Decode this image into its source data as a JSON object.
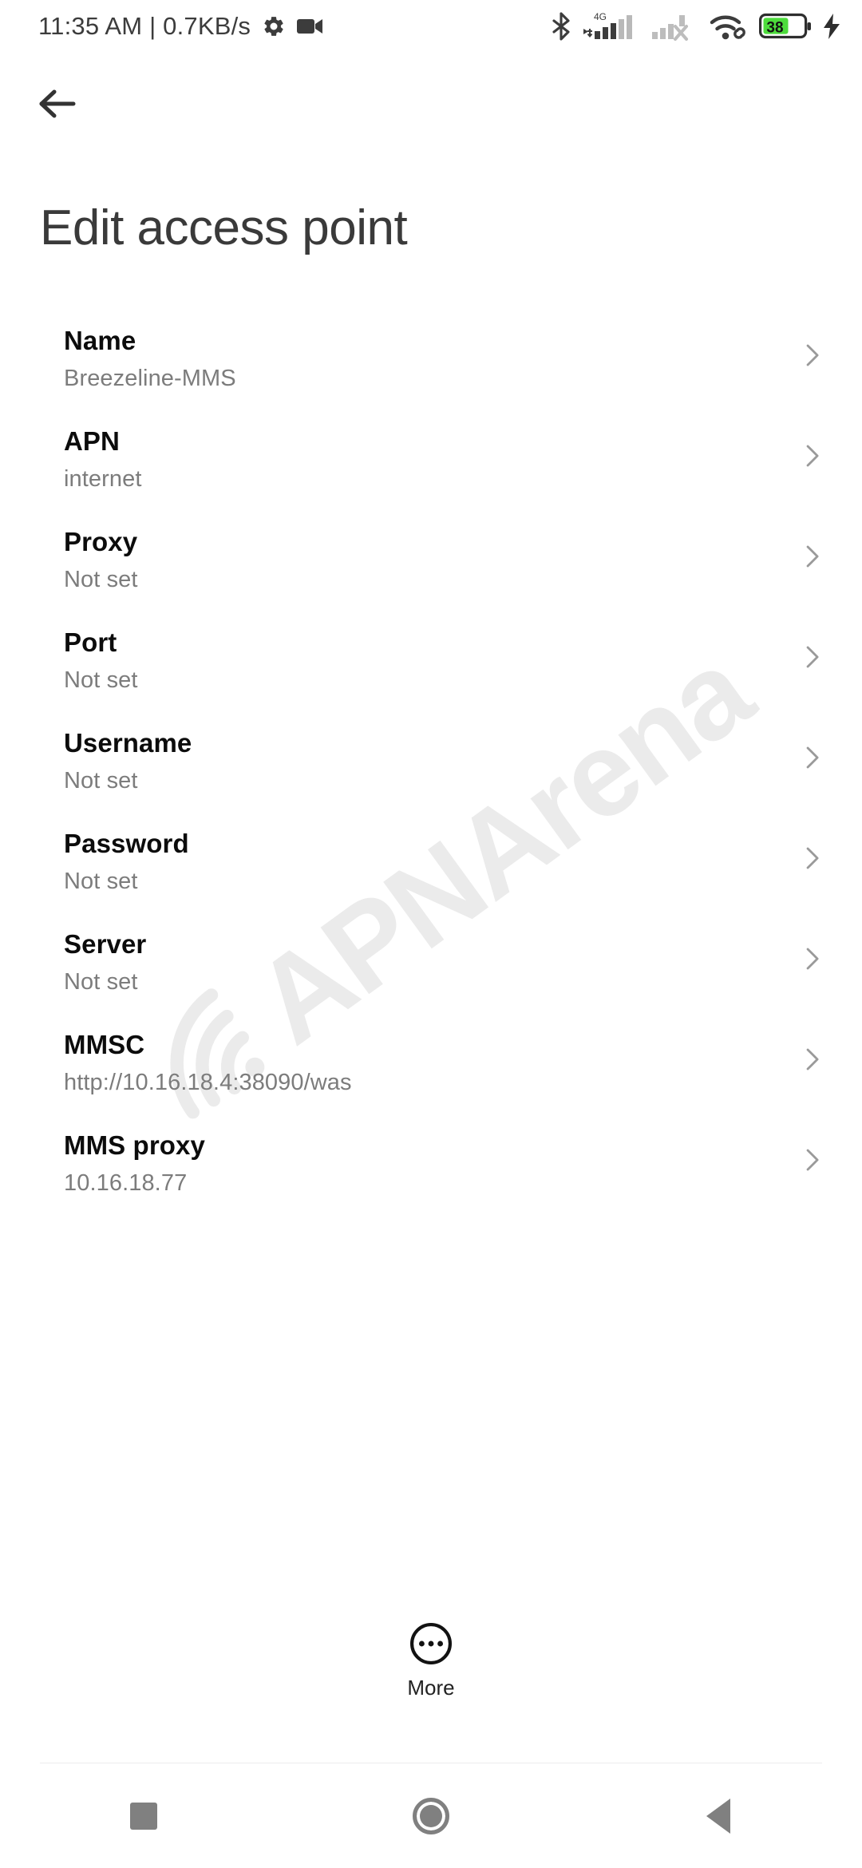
{
  "status_bar": {
    "clock": "11:35 AM | 0.7KB/s",
    "left_icons": [
      {
        "name": "gear-icon",
        "label": "settings"
      },
      {
        "name": "video-camera-icon",
        "label": "screen recorder"
      }
    ],
    "right_icons": [
      {
        "name": "bluetooth-icon",
        "label": "Bluetooth"
      },
      {
        "name": "signal-4g-icon",
        "label": "4G",
        "network_label": "4G"
      },
      {
        "name": "signal-no-service-icon",
        "label": "SIM 2 no service"
      },
      {
        "name": "wifi-icon",
        "label": "Wi-Fi connected"
      },
      {
        "name": "battery-icon",
        "label": "Battery",
        "percent": "38"
      },
      {
        "name": "charging-bolt-icon",
        "label": "Charging"
      }
    ],
    "battery_percent": "38",
    "battery_color": "#4ddc3c"
  },
  "navigation": {
    "back_label": "Back"
  },
  "header": {
    "title": "Edit access point"
  },
  "list": {
    "chevron_name": "chevron-right-icon",
    "items": [
      {
        "label": "Name",
        "value": "Breezeline-MMS"
      },
      {
        "label": "APN",
        "value": "internet"
      },
      {
        "label": "Proxy",
        "value": "Not set"
      },
      {
        "label": "Port",
        "value": "Not set"
      },
      {
        "label": "Username",
        "value": "Not set"
      },
      {
        "label": "Password",
        "value": "Not set"
      },
      {
        "label": "Server",
        "value": "Not set"
      },
      {
        "label": "MMSC",
        "value": "http://10.16.18.4:38090/was"
      },
      {
        "label": "MMS proxy",
        "value": "10.16.18.77"
      }
    ]
  },
  "more_button": {
    "label": "More"
  },
  "watermark": {
    "text": "APNArena"
  },
  "system_nav": {
    "recents_label": "Recents",
    "home_label": "Home",
    "back_label": "Back"
  },
  "colors": {
    "text_primary": "#0c0c0c",
    "text_secondary": "#7c7c7c",
    "title": "#3a3a3a",
    "chevron": "#9a9a9a",
    "watermark": "#ebebeb",
    "navbar_icon": "#808080"
  }
}
